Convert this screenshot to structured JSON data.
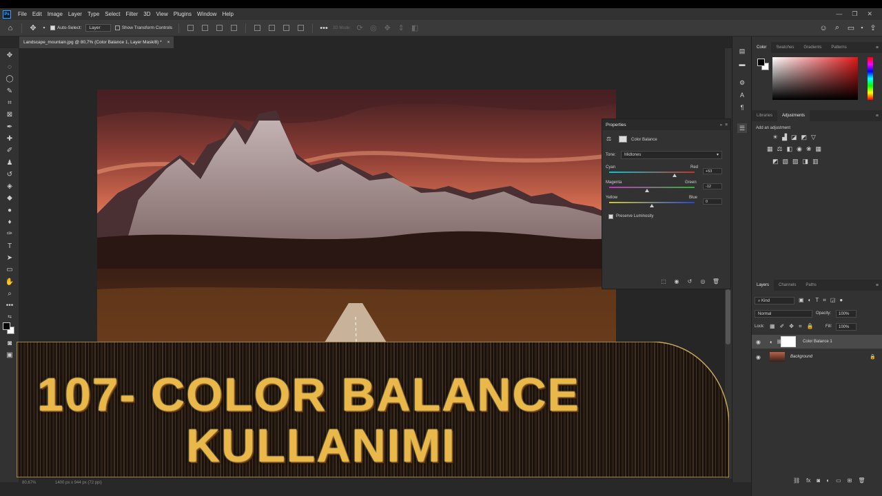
{
  "app": {
    "logo": "Ps"
  },
  "menu": [
    "File",
    "Edit",
    "Image",
    "Layer",
    "Type",
    "Select",
    "Filter",
    "3D",
    "View",
    "Plugins",
    "Window",
    "Help"
  ],
  "window_controls": [
    "minimize-icon",
    "restore-icon",
    "close-icon"
  ],
  "options": {
    "auto_select_label": "Auto-Select:",
    "auto_select_value": "Layer",
    "show_transform_label": "Show Transform Controls",
    "mode_3d_label": "3D Mode:"
  },
  "document_tab": {
    "title": "Landscape_mountain.jpg @ 80,7% (Color Balance 1, Layer Mask/8) *",
    "close": "×"
  },
  "right_panel": {
    "color_tabs": [
      "Color",
      "Swatches",
      "Gradients",
      "Patterns"
    ],
    "adj_tabs": [
      "Libraries",
      "Adjustments"
    ],
    "add_adjustment": "Add an adjustment",
    "layers_tabs": [
      "Layers",
      "Channels",
      "Paths"
    ],
    "kind_label": "Kind",
    "blend_mode": "Normal",
    "opacity_label": "Opacity:",
    "opacity_value": "100%",
    "lock_label": "Lock:",
    "fill_label": "Fill:",
    "fill_value": "100%",
    "layers": [
      {
        "name": "Color Balance 1",
        "selected": true
      },
      {
        "name": "Background",
        "selected": false
      }
    ]
  },
  "properties": {
    "title": "Properties",
    "adjustment_name": "Color Balance",
    "tone_label": "Tone:",
    "tone_value": "Midtones",
    "sliders": [
      {
        "left": "Cyan",
        "right": "Red",
        "value": "+53",
        "position": 0.765
      },
      {
        "left": "Magenta",
        "right": "Green",
        "value": "-12",
        "position": 0.44
      },
      {
        "left": "Yellow",
        "right": "Blue",
        "value": "0",
        "position": 0.5
      }
    ],
    "preserve_luminosity": "Preserve Luminosity"
  },
  "banner": {
    "line1": "107-  COLOR BALANCE",
    "line2": "KULLANIMI"
  },
  "status": {
    "zoom": "80,67%",
    "doc_size": "1400 px x 944 px (72 ppi)"
  },
  "colors": {
    "accent": "#31a8ff",
    "banner_text": "#e9b848",
    "panel": "#323232"
  }
}
